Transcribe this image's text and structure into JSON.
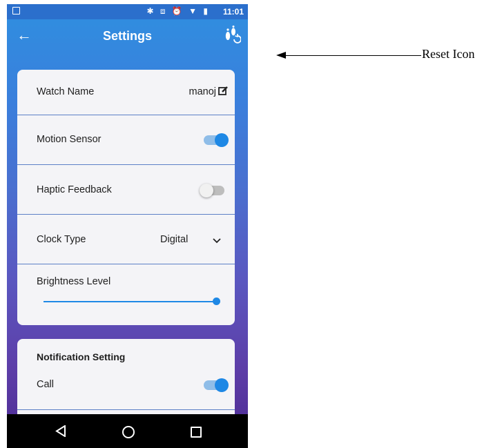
{
  "statusbar": {
    "time": "11:01",
    "icons": "✱ ⧈ ⏰ ▼ ▮"
  },
  "appbar": {
    "title": "Settings"
  },
  "settings": {
    "watch_name_label": "Watch Name",
    "watch_name_value": "manoj",
    "motion_sensor_label": "Motion Sensor",
    "motion_sensor_on": true,
    "haptic_feedback_label": "Haptic Feedback",
    "haptic_feedback_on": false,
    "clock_type_label": "Clock Type",
    "clock_type_value": "Digital",
    "brightness_label": "Brightness Level",
    "brightness_level": 1.0
  },
  "notifications": {
    "header": "Notification Setting",
    "call_label": "Call",
    "call_on": true
  },
  "annotation": {
    "text": "Reset Icon"
  },
  "colors": {
    "accent": "#1e88e5",
    "appbar": "#2b6fcc",
    "card": "#f4f4f7",
    "divider": "#5b7fc6"
  }
}
